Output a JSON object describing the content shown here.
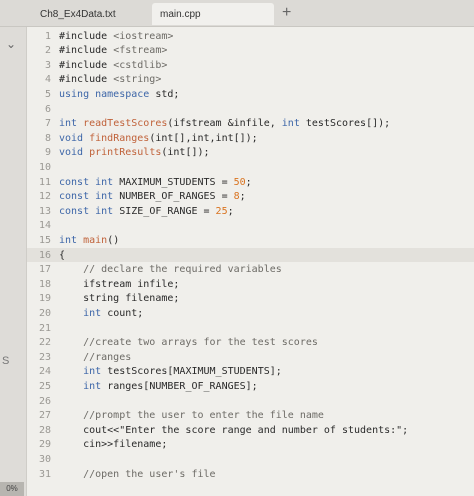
{
  "tabs": [
    {
      "label": "Ch8_Ex4Data.txt"
    },
    {
      "label": "main.cpp"
    }
  ],
  "new_tab_symbol": "+",
  "side_label": "S",
  "zoom_label": "0%",
  "code_lines": [
    {
      "num": "1",
      "segments": [
        {
          "t": "#include ",
          "c": "plain"
        },
        {
          "t": "<iostream>",
          "c": "inc"
        }
      ]
    },
    {
      "num": "2",
      "segments": [
        {
          "t": "#include ",
          "c": "plain"
        },
        {
          "t": "<fstream>",
          "c": "inc"
        }
      ]
    },
    {
      "num": "3",
      "segments": [
        {
          "t": "#include ",
          "c": "plain"
        },
        {
          "t": "<cstdlib>",
          "c": "inc"
        }
      ]
    },
    {
      "num": "4",
      "segments": [
        {
          "t": "#include ",
          "c": "plain"
        },
        {
          "t": "<string>",
          "c": "inc"
        }
      ]
    },
    {
      "num": "5",
      "segments": [
        {
          "t": "using namespace ",
          "c": "kw"
        },
        {
          "t": "std;",
          "c": "plain"
        }
      ]
    },
    {
      "num": "6",
      "segments": []
    },
    {
      "num": "7",
      "segments": [
        {
          "t": "int ",
          "c": "ty"
        },
        {
          "t": "readTestScores",
          "c": "fn"
        },
        {
          "t": "(ifstream &infile, ",
          "c": "plain"
        },
        {
          "t": "int ",
          "c": "ty"
        },
        {
          "t": "testScores[]);",
          "c": "plain"
        }
      ]
    },
    {
      "num": "8",
      "segments": [
        {
          "t": "void ",
          "c": "ty"
        },
        {
          "t": "findRanges",
          "c": "fn"
        },
        {
          "t": "(int[],int,int[]);",
          "c": "plain"
        }
      ]
    },
    {
      "num": "9",
      "segments": [
        {
          "t": "void ",
          "c": "ty"
        },
        {
          "t": "printResults",
          "c": "fn"
        },
        {
          "t": "(int[]);",
          "c": "plain"
        }
      ]
    },
    {
      "num": "10",
      "segments": []
    },
    {
      "num": "11",
      "segments": [
        {
          "t": "const ",
          "c": "kw"
        },
        {
          "t": "int ",
          "c": "ty"
        },
        {
          "t": "MAXIMUM_STUDENTS = ",
          "c": "plain"
        },
        {
          "t": "50",
          "c": "num"
        },
        {
          "t": ";",
          "c": "plain"
        }
      ]
    },
    {
      "num": "12",
      "segments": [
        {
          "t": "const ",
          "c": "kw"
        },
        {
          "t": "int ",
          "c": "ty"
        },
        {
          "t": "NUMBER_OF_RANGES = ",
          "c": "plain"
        },
        {
          "t": "8",
          "c": "num"
        },
        {
          "t": ";",
          "c": "plain"
        }
      ]
    },
    {
      "num": "13",
      "segments": [
        {
          "t": "const ",
          "c": "kw"
        },
        {
          "t": "int ",
          "c": "ty"
        },
        {
          "t": "SIZE_OF_RANGE = ",
          "c": "plain"
        },
        {
          "t": "25",
          "c": "num"
        },
        {
          "t": ";",
          "c": "plain"
        }
      ]
    },
    {
      "num": "14",
      "segments": []
    },
    {
      "num": "15",
      "segments": [
        {
          "t": "int ",
          "c": "ty"
        },
        {
          "t": "main",
          "c": "fn"
        },
        {
          "t": "()",
          "c": "plain"
        }
      ]
    },
    {
      "num": "16",
      "segments": [
        {
          "t": "{",
          "c": "plain"
        }
      ]
    },
    {
      "num": "17",
      "segments": [
        {
          "t": "    // declare the required variables",
          "c": "cm"
        }
      ]
    },
    {
      "num": "18",
      "segments": [
        {
          "t": "    ifstream infile;",
          "c": "plain"
        }
      ]
    },
    {
      "num": "19",
      "segments": [
        {
          "t": "    string filename;",
          "c": "plain"
        }
      ]
    },
    {
      "num": "20",
      "segments": [
        {
          "t": "    ",
          "c": "plain"
        },
        {
          "t": "int ",
          "c": "ty"
        },
        {
          "t": "count;",
          "c": "plain"
        }
      ]
    },
    {
      "num": "21",
      "segments": []
    },
    {
      "num": "22",
      "segments": [
        {
          "t": "    //create two arrays for the test scores",
          "c": "cm"
        }
      ]
    },
    {
      "num": "23",
      "segments": [
        {
          "t": "    //ranges",
          "c": "cm"
        }
      ]
    },
    {
      "num": "24",
      "segments": [
        {
          "t": "    ",
          "c": "plain"
        },
        {
          "t": "int ",
          "c": "ty"
        },
        {
          "t": "testScores[MAXIMUM_STUDENTS];",
          "c": "plain"
        }
      ]
    },
    {
      "num": "25",
      "segments": [
        {
          "t": "    ",
          "c": "plain"
        },
        {
          "t": "int ",
          "c": "ty"
        },
        {
          "t": "ranges[NUMBER_OF_RANGES];",
          "c": "plain"
        }
      ]
    },
    {
      "num": "26",
      "segments": []
    },
    {
      "num": "27",
      "segments": [
        {
          "t": "    //prompt the user to enter the file name",
          "c": "cm"
        }
      ]
    },
    {
      "num": "28",
      "segments": [
        {
          "t": "    cout<<\"Enter the score range and number of students:\";",
          "c": "plain"
        }
      ]
    },
    {
      "num": "29",
      "segments": [
        {
          "t": "    cin>>filename;",
          "c": "plain"
        }
      ]
    },
    {
      "num": "30",
      "segments": []
    },
    {
      "num": "31",
      "segments": [
        {
          "t": "    //open the user's file",
          "c": "cm"
        }
      ]
    }
  ]
}
